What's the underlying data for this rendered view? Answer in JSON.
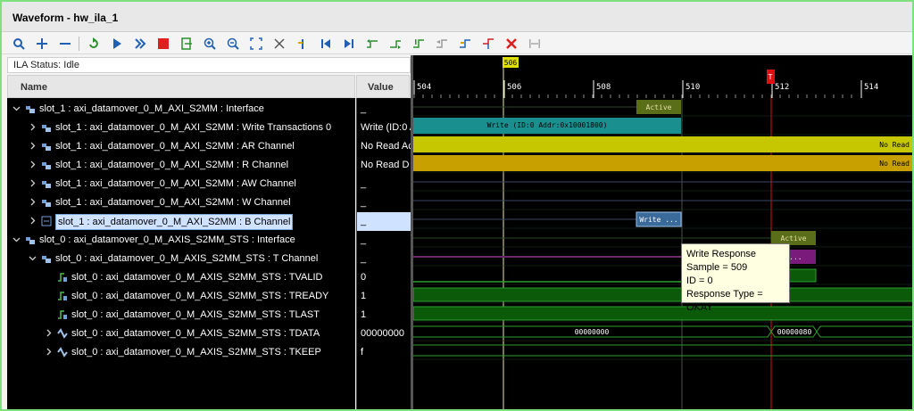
{
  "window": {
    "title": "Waveform - hw_ila_1"
  },
  "toolbar": {
    "icons": [
      "search-icon",
      "add-icon",
      "remove-icon",
      "refresh-icon",
      "run-trigger-icon",
      "run-immediate-icon",
      "stop-icon",
      "export-icon",
      "zoom-in-icon",
      "zoom-out-icon",
      "zoom-fit-icon",
      "cursor-icon",
      "add-marker-icon",
      "go-to-start-icon",
      "go-to-end-icon",
      "previous-transition-icon",
      "next-transition-icon",
      "add-marker-alt-icon",
      "prev-marker-icon",
      "next-marker-icon",
      "swap-cursors-icon",
      "delete-icon",
      "zoom-to-marker-icon"
    ]
  },
  "status": {
    "text": "ILA Status: Idle"
  },
  "columns": {
    "name": "Name",
    "value": "Value"
  },
  "rows": [
    {
      "label": "slot_1 : axi_datamover_0_M_AXI_S2MM : Interface",
      "value": "_"
    },
    {
      "label": "slot_1 : axi_datamover_0_M_AXI_S2MM : Write Transactions 0",
      "value": "Write (ID:0 A"
    },
    {
      "label": "slot_1 : axi_datamover_0_M_AXI_S2MM : AR Channel",
      "value": "No Read Ac"
    },
    {
      "label": "slot_1 : axi_datamover_0_M_AXI_S2MM : R Channel",
      "value": "No Read D"
    },
    {
      "label": "slot_1 : axi_datamover_0_M_AXI_S2MM : AW Channel",
      "value": "_"
    },
    {
      "label": "slot_1 : axi_datamover_0_M_AXI_S2MM : W Channel",
      "value": "_"
    },
    {
      "label": "slot_1 : axi_datamover_0_M_AXI_S2MM : B Channel",
      "value": "_"
    },
    {
      "label": "slot_0 : axi_datamover_0_M_AXIS_S2MM_STS : Interface",
      "value": "_"
    },
    {
      "label": "slot_0 : axi_datamover_0_M_AXIS_S2MM_STS : T Channel",
      "value": "_"
    },
    {
      "label": "slot_0 : axi_datamover_0_M_AXIS_S2MM_STS : TVALID",
      "value": "0"
    },
    {
      "label": "slot_0 : axi_datamover_0_M_AXIS_S2MM_STS : TREADY",
      "value": "1"
    },
    {
      "label": "slot_0 : axi_datamover_0_M_AXIS_S2MM_STS : TLAST",
      "value": "1"
    },
    {
      "label": "slot_0 : axi_datamover_0_M_AXIS_S2MM_STS : TDATA",
      "value": "00000000"
    },
    {
      "label": "slot_0 : axi_datamover_0_M_AXIS_S2MM_STS : TKEEP",
      "value": "f"
    }
  ],
  "timeline": {
    "ticks": [
      "504",
      "506",
      "508",
      "510",
      "512",
      "514"
    ],
    "cursor_marker": "506",
    "trigger_marker": "T"
  },
  "wave_labels": {
    "active_top": "Active",
    "write_txn": "Write (ID:0 Addr:0x10001800)",
    "no_read_ar": "No Read",
    "no_read_r": "No Read",
    "b_write": "Write ...",
    "active_t": "Active",
    "t_short": "S...",
    "tdata_a": "00000000",
    "tdata_b": "00000080"
  },
  "tooltip": {
    "line1": "Write Response",
    "line2": "Sample = 509",
    "line3": "ID = 0",
    "line4": "Response Type = OKAY"
  },
  "colors": {
    "teal": "#1a8f8f",
    "yellow": "#c7c700",
    "olive": "#5a6e1a",
    "green": "#1e7a1e",
    "purple": "#7a1a7a",
    "trigger": "#e01010"
  }
}
